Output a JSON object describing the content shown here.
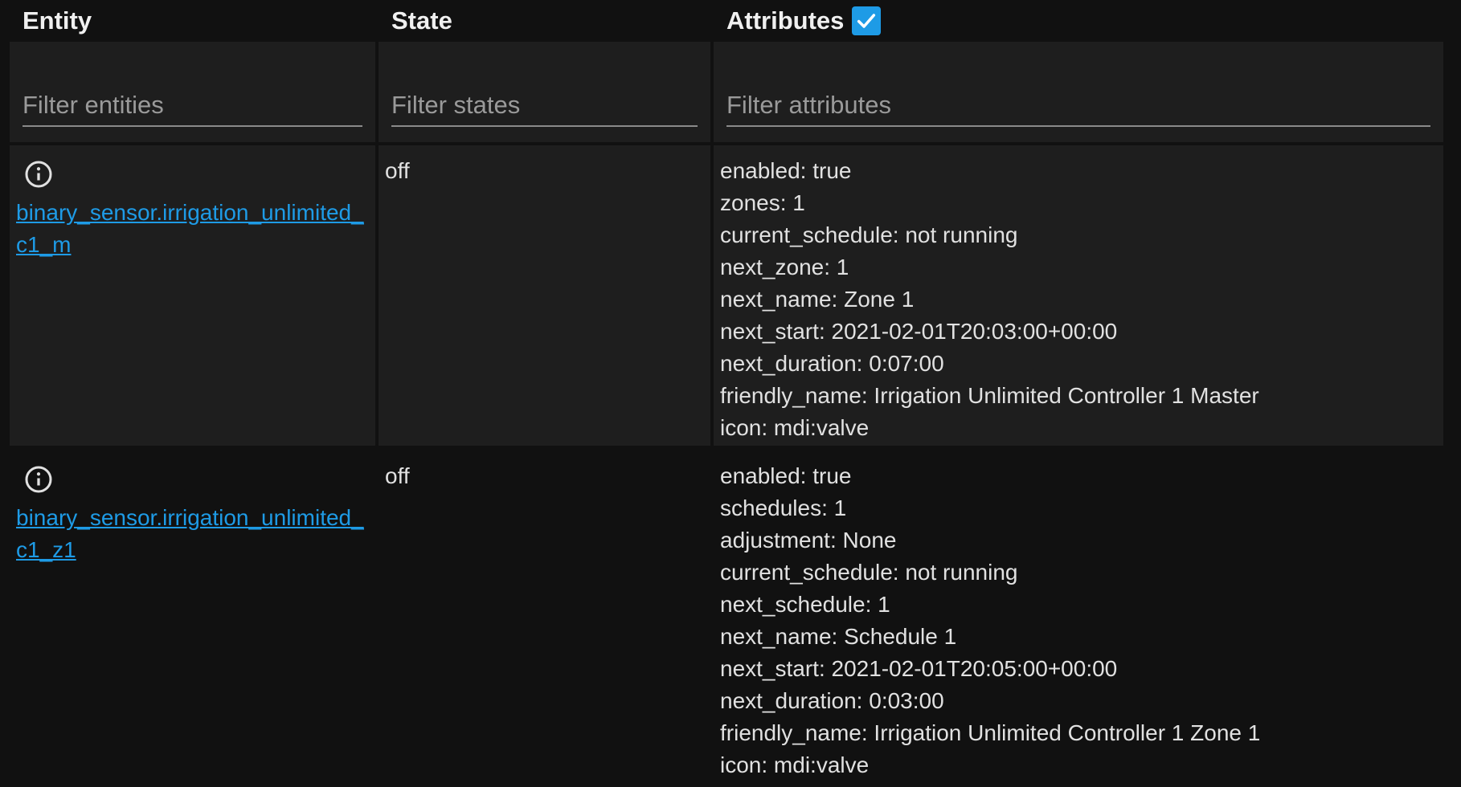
{
  "header": {
    "entity": "Entity",
    "state": "State",
    "attributes": "Attributes",
    "attributes_checkbox_checked": true
  },
  "filters": {
    "entities_placeholder": "Filter entities",
    "states_placeholder": "Filter states",
    "attributes_placeholder": "Filter attributes"
  },
  "colors": {
    "accent": "#1e9be6",
    "background": "#111111",
    "row_alt": "#1e1e1e",
    "text": "#e1e1e1"
  },
  "rows": [
    {
      "icon": "info-icon",
      "entity": "binary_sensor.irrigation_unlimited_c1_m",
      "state": "off",
      "attributes": [
        "enabled: true",
        "zones: 1",
        "current_schedule: not running",
        "next_zone: 1",
        "next_name: Zone 1",
        "next_start: 2021-02-01T20:03:00+00:00",
        "next_duration: 0:07:00",
        "friendly_name: Irrigation Unlimited Controller 1 Master",
        "icon: mdi:valve"
      ]
    },
    {
      "icon": "info-icon",
      "entity": "binary_sensor.irrigation_unlimited_c1_z1",
      "state": "off",
      "attributes": [
        "enabled: true",
        "schedules: 1",
        "adjustment: None",
        "current_schedule: not running",
        "next_schedule: 1",
        "next_name: Schedule 1",
        "next_start: 2021-02-01T20:05:00+00:00",
        "next_duration: 0:03:00",
        "friendly_name: Irrigation Unlimited Controller 1 Zone 1",
        "icon: mdi:valve"
      ]
    }
  ]
}
